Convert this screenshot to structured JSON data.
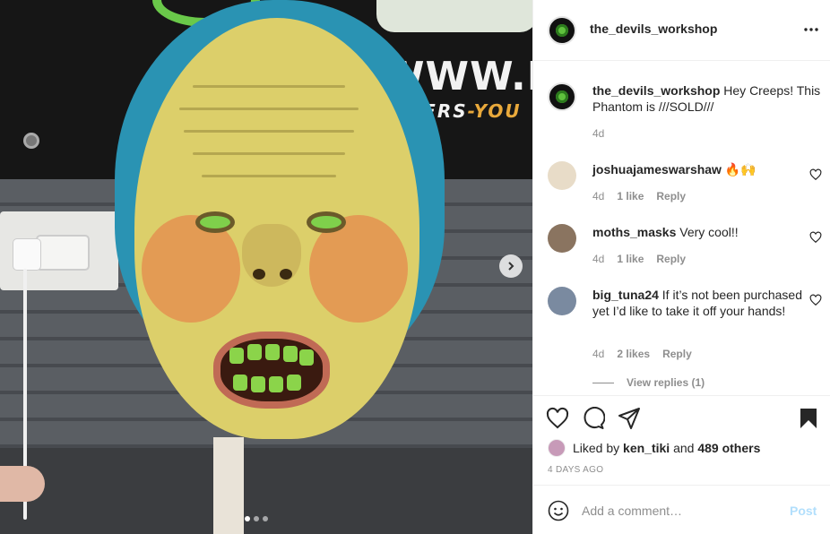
{
  "post": {
    "username": "the_devils_workshop",
    "caption": "Hey Creeps! This Phantom is ///SOLD///",
    "caption_age": "4d",
    "banner_text": "WWW.DEV",
    "banner_sub_a": "CKERS",
    "banner_sub_b": "-YOU",
    "photo_dots": 3,
    "photo_active_dot": 1
  },
  "comments": [
    {
      "username": "joshuajameswarshaw",
      "text": "🔥🙌",
      "age": "4d",
      "likes": "1 like",
      "reply": "Reply",
      "avatar_color": "#e8dcc8"
    },
    {
      "username": "moths_masks",
      "text": "Very cool!!",
      "age": "4d",
      "likes": "1 like",
      "reply": "Reply",
      "avatar_color": "#8a7460"
    },
    {
      "username": "big_tuna24",
      "text": "If it’s not been purchased yet I’d like to take it off your hands!",
      "age": "4d",
      "likes": "2 likes",
      "reply": "Reply",
      "avatar_color": "#7a8aa0"
    }
  ],
  "view_replies": "View replies (1)",
  "likes": {
    "prefix": "Liked by ",
    "user": "ken_tiki",
    "middle": " and ",
    "count": "489 others"
  },
  "timestamp": "4 DAYS AGO",
  "comment_box": {
    "placeholder": "Add a comment…",
    "post_label": "Post"
  },
  "colors": {
    "accent_post": "#b2dffc",
    "muted": "#8e8e8e"
  },
  "icons": [
    "more-icon",
    "heart-icon",
    "comment-icon",
    "share-icon",
    "bookmark-icon",
    "emoji-icon",
    "chevron-right-icon"
  ]
}
